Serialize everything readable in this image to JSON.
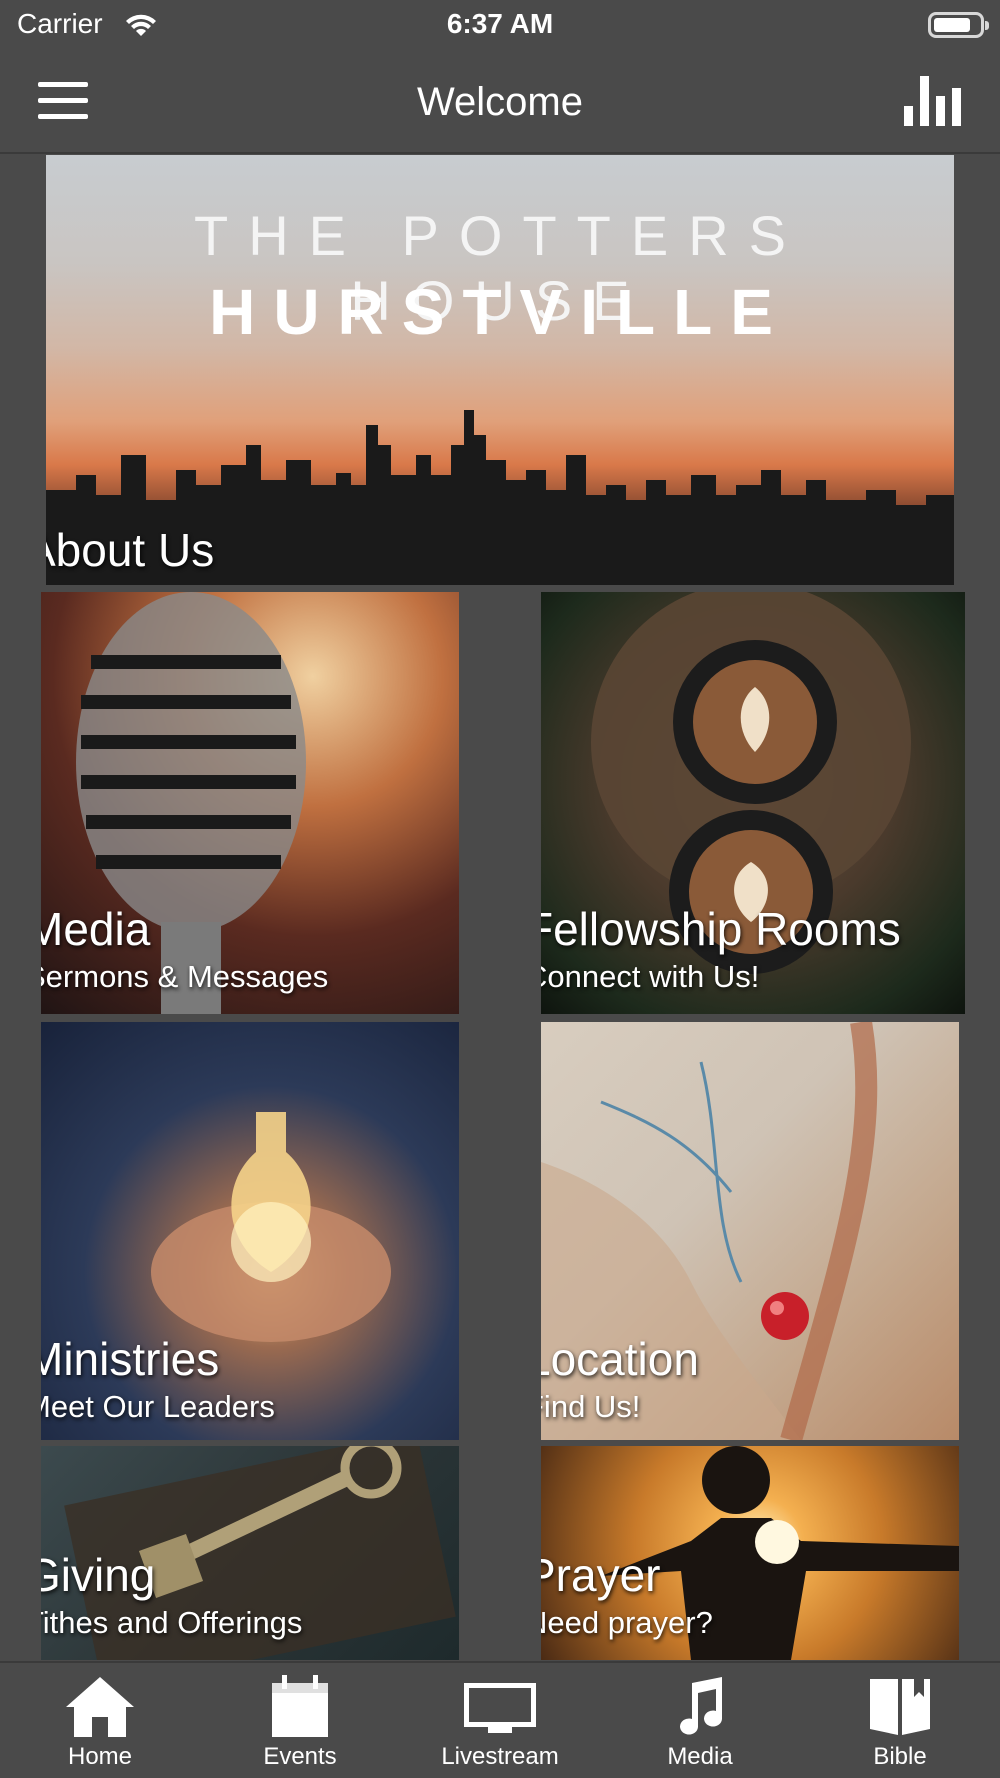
{
  "status_bar": {
    "carrier": "Carrier",
    "time": "6:37 AM"
  },
  "nav": {
    "title": "Welcome"
  },
  "hero": {
    "line1": "THE POTTERS HOUSE",
    "line2": "HURSTVILLE",
    "label": "About Us"
  },
  "tiles": [
    {
      "label": "Media",
      "subtitle": "Sermons & Messages"
    },
    {
      "label": "Fellowship Rooms",
      "subtitle": "Connect with Us!"
    },
    {
      "label": "Ministries",
      "subtitle": "Meet Our Leaders"
    },
    {
      "label": "Location",
      "subtitle": "Find Us!"
    },
    {
      "label": "Giving",
      "subtitle": "Tithes and Offerings"
    },
    {
      "label": "Prayer",
      "subtitle": "Need prayer?"
    }
  ],
  "tab_bar": {
    "items": [
      {
        "label": "Home",
        "icon": "home-icon"
      },
      {
        "label": "Events",
        "icon": "calendar-icon"
      },
      {
        "label": "Livestream",
        "icon": "monitor-icon"
      },
      {
        "label": "Media",
        "icon": "music-note-icon"
      },
      {
        "label": "Bible",
        "icon": "book-icon"
      }
    ]
  },
  "colors": {
    "background": "#4a4a4a",
    "text": "#ffffff"
  }
}
